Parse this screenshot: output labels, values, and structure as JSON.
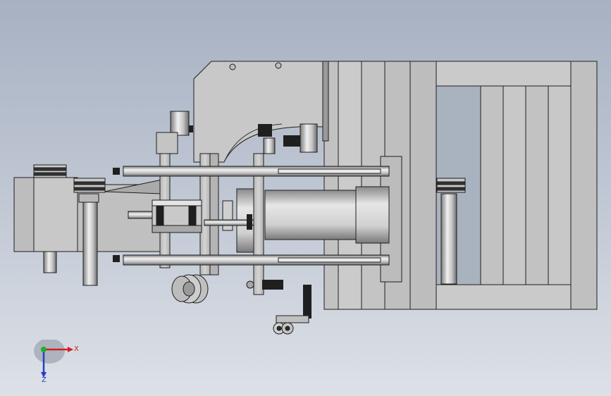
{
  "viewport": {
    "background_top": "#a7b1c2",
    "background_bottom": "#dde1e7"
  },
  "model": {
    "view": "top",
    "body_color": "#c4c4c4",
    "shade_color": "#9e9e9e",
    "dark_color": "#2a2a2a",
    "outline_color": "#1e1e1e"
  },
  "triad": {
    "x_label": "X",
    "z_label": "Z",
    "x_color": "#d42020",
    "y_color": "#1fae2a",
    "z_color": "#2a3bc8"
  }
}
